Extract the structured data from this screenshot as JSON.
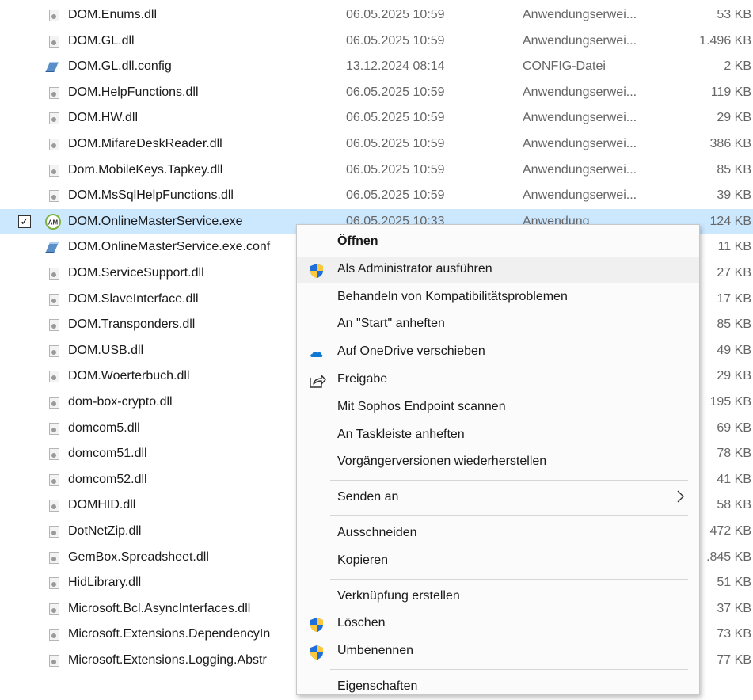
{
  "files": [
    {
      "name": "DOM.Enums.dll",
      "date": "06.05.2025 10:59",
      "type": "Anwendungserwei...",
      "size": "53 KB",
      "icon": "dll-file-icon"
    },
    {
      "name": "DOM.GL.dll",
      "date": "06.05.2025 10:59",
      "type": "Anwendungserwei...",
      "size": "1.496 KB",
      "icon": "dll-file-icon"
    },
    {
      "name": "DOM.GL.dll.config",
      "date": "13.12.2024 08:14",
      "type": "CONFIG-Datei",
      "size": "2 KB",
      "icon": "config-file-icon"
    },
    {
      "name": "DOM.HelpFunctions.dll",
      "date": "06.05.2025 10:59",
      "type": "Anwendungserwei...",
      "size": "119 KB",
      "icon": "dll-file-icon"
    },
    {
      "name": "DOM.HW.dll",
      "date": "06.05.2025 10:59",
      "type": "Anwendungserwei...",
      "size": "29 KB",
      "icon": "dll-file-icon"
    },
    {
      "name": "DOM.MifareDeskReader.dll",
      "date": "06.05.2025 10:59",
      "type": "Anwendungserwei...",
      "size": "386 KB",
      "icon": "dll-file-icon"
    },
    {
      "name": "Dom.MobileKeys.Tapkey.dll",
      "date": "06.05.2025 10:59",
      "type": "Anwendungserwei...",
      "size": "85 KB",
      "icon": "dll-file-icon"
    },
    {
      "name": "DOM.MsSqlHelpFunctions.dll",
      "date": "06.05.2025 10:59",
      "type": "Anwendungserwei...",
      "size": "39 KB",
      "icon": "dll-file-icon"
    },
    {
      "name": "DOM.OnlineMasterService.exe",
      "date": "06.05.2025 10:33",
      "type": "Anwendung",
      "size": "124 KB",
      "icon": "exe-app-icon",
      "selected": true
    },
    {
      "name": "DOM.OnlineMasterService.exe.conf",
      "date": "",
      "type": "",
      "size": "11 KB",
      "icon": "config-file-icon"
    },
    {
      "name": "DOM.ServiceSupport.dll",
      "date": "",
      "type": "",
      "size": "27 KB",
      "icon": "dll-file-icon"
    },
    {
      "name": "DOM.SlaveInterface.dll",
      "date": "",
      "type": "",
      "size": "17 KB",
      "icon": "dll-file-icon"
    },
    {
      "name": "DOM.Transponders.dll",
      "date": "",
      "type": "",
      "size": "85 KB",
      "icon": "dll-file-icon"
    },
    {
      "name": "DOM.USB.dll",
      "date": "",
      "type": "",
      "size": "49 KB",
      "icon": "dll-file-icon"
    },
    {
      "name": "DOM.Woerterbuch.dll",
      "date": "",
      "type": "",
      "size": "29 KB",
      "icon": "dll-file-icon"
    },
    {
      "name": "dom-box-crypto.dll",
      "date": "",
      "type": "",
      "size": "195 KB",
      "icon": "dll-file-icon"
    },
    {
      "name": "domcom5.dll",
      "date": "",
      "type": "",
      "size": "69 KB",
      "icon": "dll-file-icon"
    },
    {
      "name": "domcom51.dll",
      "date": "",
      "type": "",
      "size": "78 KB",
      "icon": "dll-file-icon"
    },
    {
      "name": "domcom52.dll",
      "date": "",
      "type": "",
      "size": "41 KB",
      "icon": "dll-file-icon"
    },
    {
      "name": "DOMHID.dll",
      "date": "",
      "type": "",
      "size": "58 KB",
      "icon": "dll-file-icon"
    },
    {
      "name": "DotNetZip.dll",
      "date": "",
      "type": "",
      "size": "472 KB",
      "icon": "dll-file-icon"
    },
    {
      "name": "GemBox.Spreadsheet.dll",
      "date": "",
      "type": "",
      "size": ".845 KB",
      "icon": "dll-file-icon"
    },
    {
      "name": "HidLibrary.dll",
      "date": "",
      "type": "",
      "size": "51 KB",
      "icon": "dll-file-icon"
    },
    {
      "name": "Microsoft.Bcl.AsyncInterfaces.dll",
      "date": "",
      "type": "",
      "size": "37 KB",
      "icon": "dll-file-icon"
    },
    {
      "name": "Microsoft.Extensions.DependencyIn",
      "date": "",
      "type": "",
      "size": "73 KB",
      "icon": "dll-file-icon"
    },
    {
      "name": "Microsoft.Extensions.Logging.Abstr",
      "date": "",
      "type": "",
      "size": "77 KB",
      "icon": "dll-file-icon"
    }
  ],
  "context_menu": {
    "items": [
      {
        "label": "Öffnen",
        "icon": "",
        "bold": true
      },
      {
        "label": "Als Administrator ausführen",
        "icon": "uac-shield-icon",
        "hover": true
      },
      {
        "label": "Behandeln von Kompatibilitätsproblemen",
        "icon": ""
      },
      {
        "label": "An \"Start\" anheften",
        "icon": ""
      },
      {
        "label": "Auf OneDrive verschieben",
        "icon": "onedrive-cloud-icon"
      },
      {
        "label": "Freigabe",
        "icon": "share-icon"
      },
      {
        "label": "Mit Sophos Endpoint scannen",
        "icon": ""
      },
      {
        "label": "An Taskleiste anheften",
        "icon": ""
      },
      {
        "label": "Vorgängerversionen wiederherstellen",
        "icon": ""
      },
      {
        "separator": true
      },
      {
        "label": "Senden an",
        "icon": "",
        "submenu": true
      },
      {
        "separator": true
      },
      {
        "label": "Ausschneiden",
        "icon": ""
      },
      {
        "label": "Kopieren",
        "icon": ""
      },
      {
        "separator": true
      },
      {
        "label": "Verknüpfung erstellen",
        "icon": ""
      },
      {
        "label": "Löschen",
        "icon": "uac-shield-icon"
      },
      {
        "label": "Umbenennen",
        "icon": "uac-shield-icon"
      },
      {
        "separator": true
      },
      {
        "label": "Eigenschaften",
        "icon": ""
      }
    ]
  },
  "colors": {
    "selection": "#cce8ff",
    "accent_green": "#7cb342",
    "onedrive_blue": "#0f78d4"
  }
}
